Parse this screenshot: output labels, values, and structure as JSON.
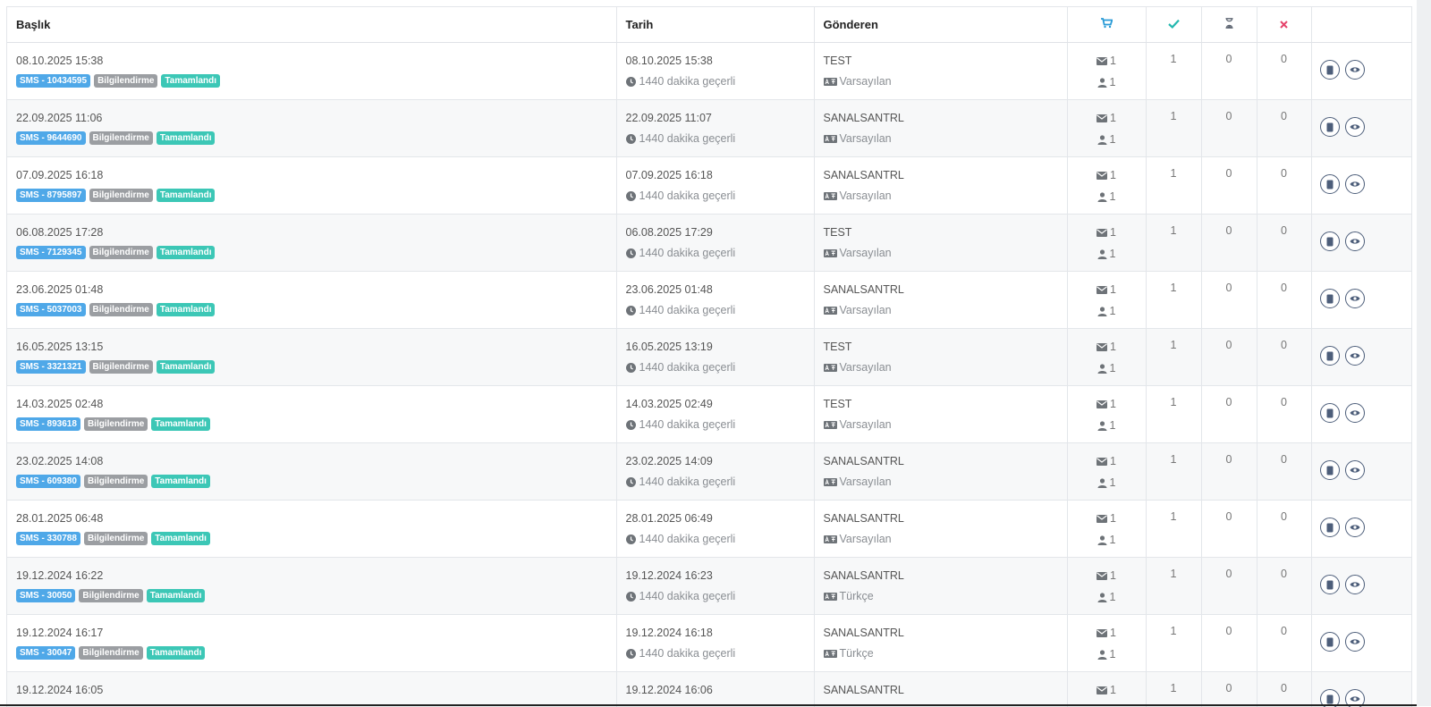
{
  "header": {
    "title_col": "Başlık",
    "date_col": "Tarih",
    "sender_col": "Gönderen",
    "cart_icon": "cart-icon",
    "check_icon": "check-icon",
    "hourglass_icon": "hourglass-icon",
    "x_icon": "x-icon"
  },
  "colors": {
    "sms_badge": "#4fa8e8",
    "type_badge": "#9b9ea2",
    "status_badge": "#3cc7b6",
    "cart": "#2a9bd6",
    "check": "#25b8b0",
    "hourglass": "#5c6470",
    "x": "#e5436b"
  },
  "rows": [
    {
      "title": "08.10.2025 15:38",
      "sms": "SMS - 10434595",
      "type": "Bilgilendirme",
      "status": "Tamamlandı",
      "date": "08.10.2025 15:38",
      "validity": "1440 dakika geçerli",
      "sender": "TEST",
      "lang": "Varsayılan",
      "msg_count": "1",
      "recipient_count": "1",
      "ok": "1",
      "pending": "0",
      "failed": "0"
    },
    {
      "title": "22.09.2025 11:06",
      "sms": "SMS - 9644690",
      "type": "Bilgilendirme",
      "status": "Tamamlandı",
      "date": "22.09.2025 11:07",
      "validity": "1440 dakika geçerli",
      "sender": "SANALSANTRL",
      "lang": "Varsayılan",
      "msg_count": "1",
      "recipient_count": "1",
      "ok": "1",
      "pending": "0",
      "failed": "0"
    },
    {
      "title": "07.09.2025 16:18",
      "sms": "SMS - 8795897",
      "type": "Bilgilendirme",
      "status": "Tamamlandı",
      "date": "07.09.2025 16:18",
      "validity": "1440 dakika geçerli",
      "sender": "SANALSANTRL",
      "lang": "Varsayılan",
      "msg_count": "1",
      "recipient_count": "1",
      "ok": "1",
      "pending": "0",
      "failed": "0"
    },
    {
      "title": "06.08.2025 17:28",
      "sms": "SMS - 7129345",
      "type": "Bilgilendirme",
      "status": "Tamamlandı",
      "date": "06.08.2025 17:29",
      "validity": "1440 dakika geçerli",
      "sender": "TEST",
      "lang": "Varsayılan",
      "msg_count": "1",
      "recipient_count": "1",
      "ok": "1",
      "pending": "0",
      "failed": "0"
    },
    {
      "title": "23.06.2025 01:48",
      "sms": "SMS - 5037003",
      "type": "Bilgilendirme",
      "status": "Tamamlandı",
      "date": "23.06.2025 01:48",
      "validity": "1440 dakika geçerli",
      "sender": "SANALSANTRL",
      "lang": "Varsayılan",
      "msg_count": "1",
      "recipient_count": "1",
      "ok": "1",
      "pending": "0",
      "failed": "0"
    },
    {
      "title": "16.05.2025 13:15",
      "sms": "SMS - 3321321",
      "type": "Bilgilendirme",
      "status": "Tamamlandı",
      "date": "16.05.2025 13:19",
      "validity": "1440 dakika geçerli",
      "sender": "TEST",
      "lang": "Varsayılan",
      "msg_count": "1",
      "recipient_count": "1",
      "ok": "1",
      "pending": "0",
      "failed": "0"
    },
    {
      "title": "14.03.2025 02:48",
      "sms": "SMS - 893618",
      "type": "Bilgilendirme",
      "status": "Tamamlandı",
      "date": "14.03.2025 02:49",
      "validity": "1440 dakika geçerli",
      "sender": "TEST",
      "lang": "Varsayılan",
      "msg_count": "1",
      "recipient_count": "1",
      "ok": "1",
      "pending": "0",
      "failed": "0"
    },
    {
      "title": "23.02.2025 14:08",
      "sms": "SMS - 609380",
      "type": "Bilgilendirme",
      "status": "Tamamlandı",
      "date": "23.02.2025 14:09",
      "validity": "1440 dakika geçerli",
      "sender": "SANALSANTRL",
      "lang": "Varsayılan",
      "msg_count": "1",
      "recipient_count": "1",
      "ok": "1",
      "pending": "0",
      "failed": "0"
    },
    {
      "title": "28.01.2025 06:48",
      "sms": "SMS - 330788",
      "type": "Bilgilendirme",
      "status": "Tamamlandı",
      "date": "28.01.2025 06:49",
      "validity": "1440 dakika geçerli",
      "sender": "SANALSANTRL",
      "lang": "Varsayılan",
      "msg_count": "1",
      "recipient_count": "1",
      "ok": "1",
      "pending": "0",
      "failed": "0"
    },
    {
      "title": "19.12.2024 16:22",
      "sms": "SMS - 30050",
      "type": "Bilgilendirme",
      "status": "Tamamlandı",
      "date": "19.12.2024 16:23",
      "validity": "1440 dakika geçerli",
      "sender": "SANALSANTRL",
      "lang": "Türkçe",
      "msg_count": "1",
      "recipient_count": "1",
      "ok": "1",
      "pending": "0",
      "failed": "0"
    },
    {
      "title": "19.12.2024 16:17",
      "sms": "SMS - 30047",
      "type": "Bilgilendirme",
      "status": "Tamamlandı",
      "date": "19.12.2024 16:18",
      "validity": "1440 dakika geçerli",
      "sender": "SANALSANTRL",
      "lang": "Türkçe",
      "msg_count": "1",
      "recipient_count": "1",
      "ok": "1",
      "pending": "0",
      "failed": "0"
    },
    {
      "title": "19.12.2024 16:05",
      "sms": "",
      "type": "",
      "status": "",
      "date": "19.12.2024 16:06",
      "validity": "",
      "sender": "SANALSANTRL",
      "lang": "",
      "msg_count": "1",
      "recipient_count": "",
      "ok": "1",
      "pending": "0",
      "failed": "0"
    }
  ]
}
